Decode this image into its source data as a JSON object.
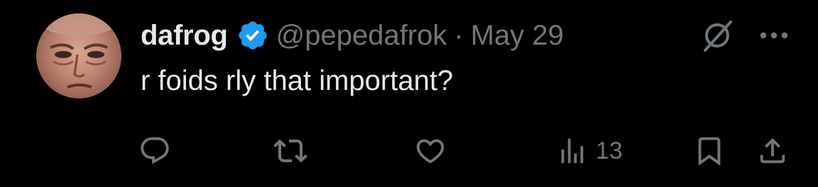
{
  "author": {
    "display_name": "dafrog",
    "handle": "@pepedafrok",
    "date": "May 29",
    "separator": "·",
    "verified_color": "#1d9bf0"
  },
  "tweet": {
    "text": "r foids rly that important?"
  },
  "actions": {
    "views_count": "13"
  },
  "icons": [
    "grok-icon",
    "more-icon",
    "reply-icon",
    "retweet-icon",
    "like-icon",
    "views-icon",
    "bookmark-icon",
    "share-icon",
    "verified-badge-icon"
  ],
  "colors": {
    "background": "#000000",
    "primary_text": "#e7e9ea",
    "secondary_text": "#71767b"
  }
}
